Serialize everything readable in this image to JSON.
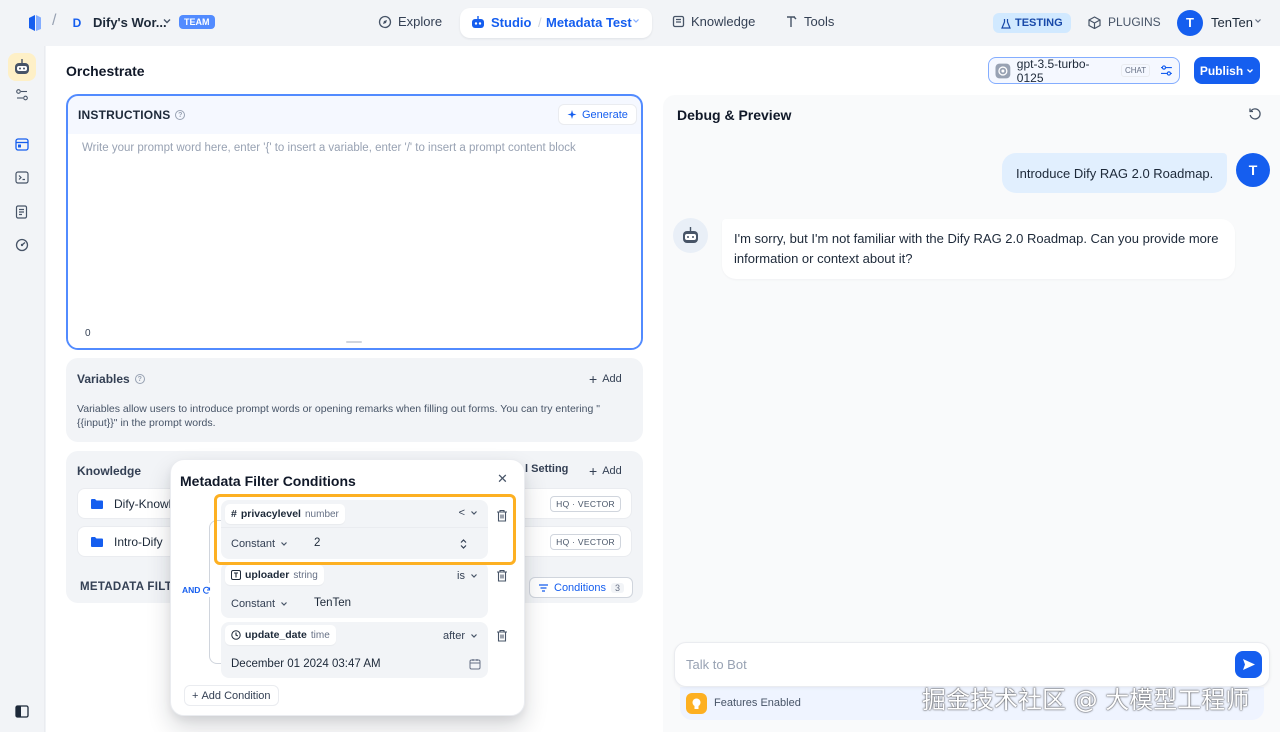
{
  "header": {
    "workspace_initial": "D",
    "workspace_name": "Dify's Wor...",
    "team_badge": "TEAM",
    "nav": {
      "explore": "Explore",
      "studio": "Studio",
      "app_name": "Metadata Test",
      "knowledge": "Knowledge",
      "tools": "Tools"
    },
    "testing_badge": "TESTING",
    "plugins": "PLUGINS",
    "user_initial": "T",
    "user_name": "TenTen"
  },
  "toolbar": {
    "title": "Orchestrate",
    "model_name": "gpt-3.5-turbo-0125",
    "model_mode": "CHAT",
    "publish_label": "Publish"
  },
  "instructions": {
    "title": "INSTRUCTIONS",
    "generate_label": "Generate",
    "placeholder": "Write your prompt word here, enter '{' to insert a variable, enter '/' to insert a prompt content block",
    "char_count": "0"
  },
  "variables": {
    "title": "Variables",
    "add_label": "Add",
    "description": "Variables allow users to introduce prompt words or opening remarks when filling out forms. You can try entering \"{{input}}\" in the prompt words."
  },
  "knowledge": {
    "title": "Knowledge",
    "setting_label": "l Setting",
    "add_label": "Add",
    "items": [
      {
        "name": "Dify-Knowl",
        "badge": "HQ · VECTOR"
      },
      {
        "name": "Intro-Dify",
        "badge": "HQ · VECTOR"
      }
    ],
    "metadata_filter_label": "METADATA FILTE",
    "conditions_label": "Conditions",
    "conditions_count": "3"
  },
  "modal": {
    "title": "Metadata Filter Conditions",
    "logic": "AND",
    "conditions": [
      {
        "field": "privacylevel",
        "type": "number",
        "operator": "<",
        "value_mode": "Constant",
        "value": "2"
      },
      {
        "field": "uploader",
        "type": "string",
        "operator": "is",
        "value_mode": "Constant",
        "value": "TenTen"
      },
      {
        "field": "update_date",
        "type": "time",
        "operator": "after",
        "value": "December 01 2024 03:47 AM"
      }
    ],
    "add_condition_label": "Add Condition"
  },
  "debug": {
    "title": "Debug & Preview",
    "user_message": "Introduce Dify RAG 2.0 Roadmap.",
    "user_initial": "T",
    "bot_message": "I'm sorry, but I'm not familiar with the Dify RAG 2.0 Roadmap. Can you provide more information or context about it?",
    "input_placeholder": "Talk to Bot",
    "features_label": "Features Enabled"
  },
  "watermark": "掘金技术社区 @ 大模型工程师",
  "colors": {
    "primary": "#155eef",
    "highlight": "#fdb022",
    "team_badge": "#528bff"
  }
}
